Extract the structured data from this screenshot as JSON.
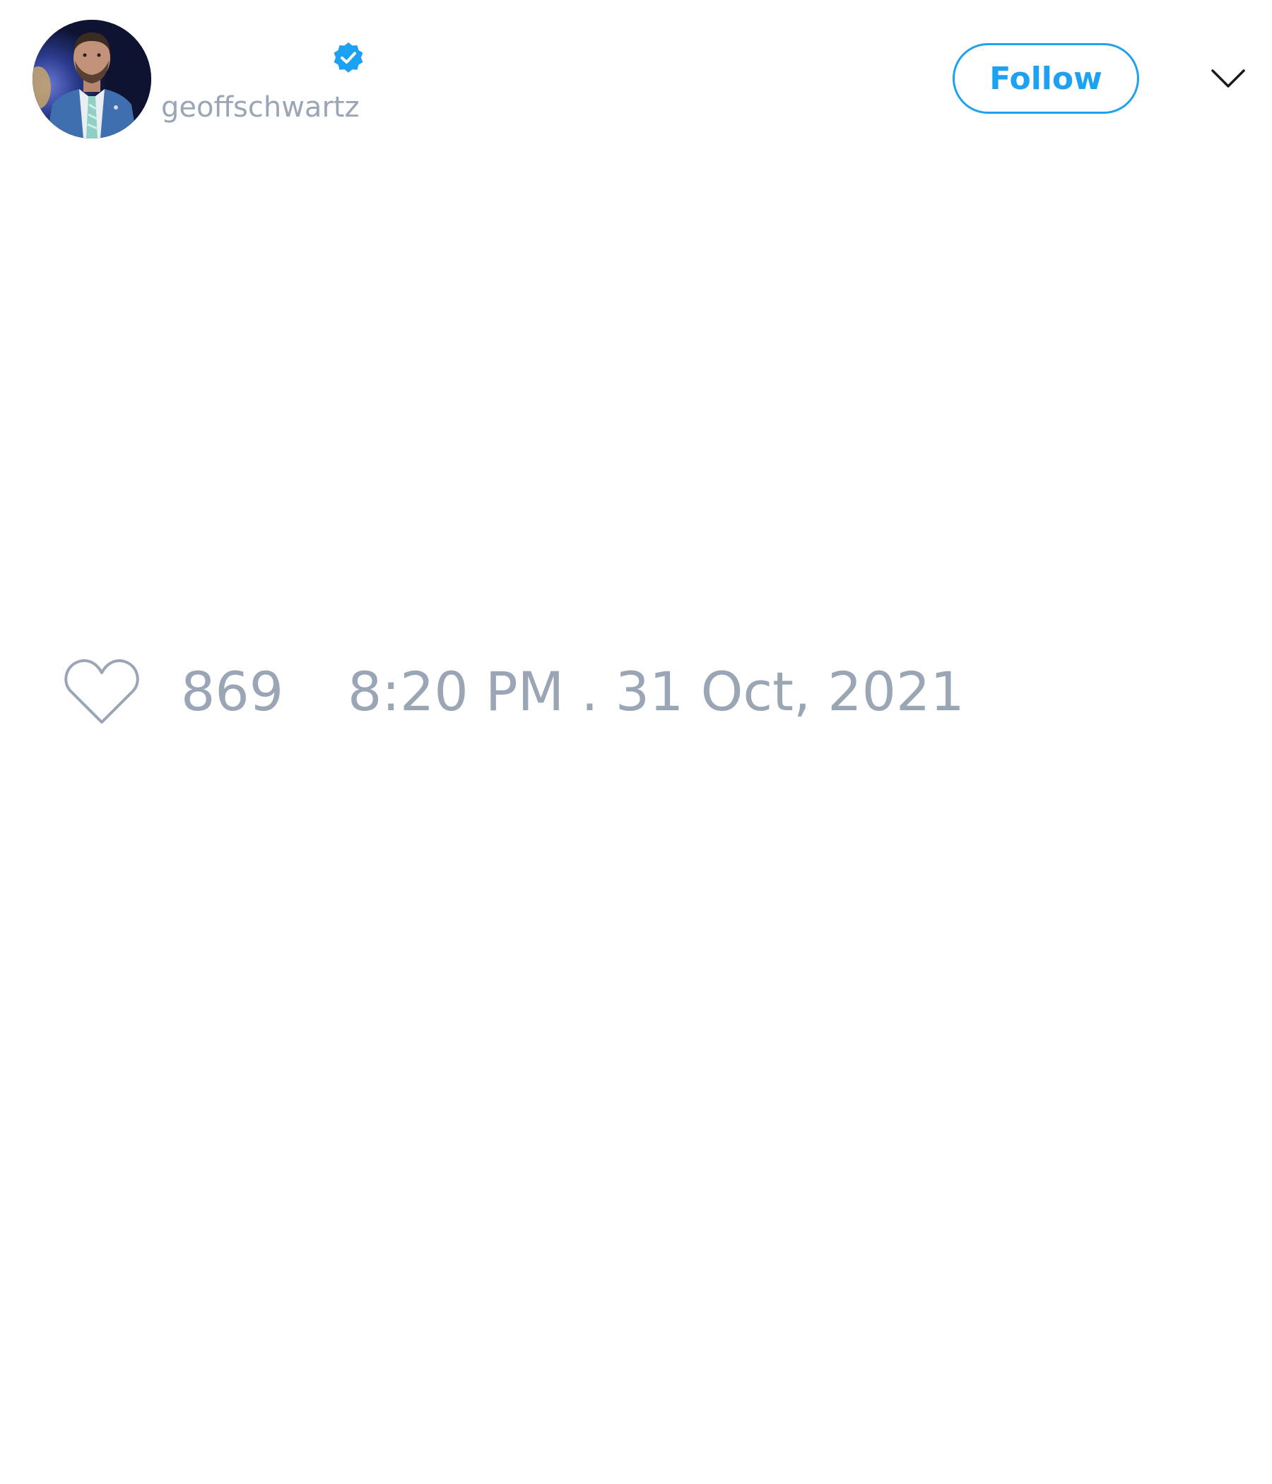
{
  "author": {
    "handle": "geoffschwartz",
    "verified": true,
    "avatar_icon": "profile-photo-man-in-blue-suit"
  },
  "header": {
    "follow_label": "Follow",
    "menu_icon": "chevron-down-icon"
  },
  "tweet": {
    "like_icon": "heart-outline-icon",
    "like_count": "869",
    "timestamp": "8:20 PM . 31 Oct, 2021"
  },
  "colors": {
    "accent": "#1da1f2",
    "muted_text": "#9aa5b5",
    "background": "#ffffff",
    "chevron": "#1a1a1a"
  }
}
